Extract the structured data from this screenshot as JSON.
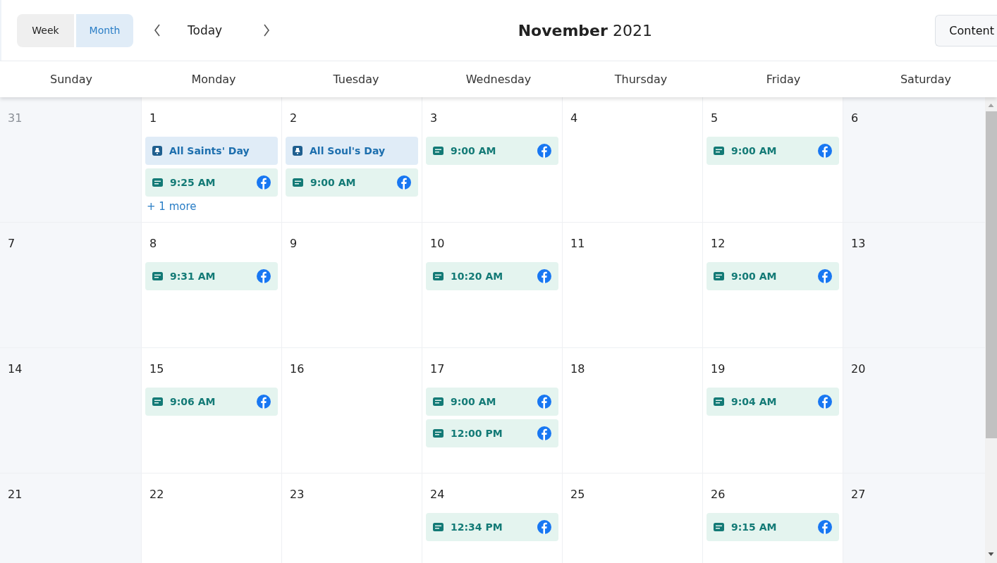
{
  "view_switch": [
    {
      "label": "Week",
      "selected": false
    },
    {
      "label": "Month",
      "selected": true
    }
  ],
  "today_button": "Today",
  "title": "**November** 2021",
  "content_button": "Content",
  "weekdays": [
    "Sunday",
    "Monday",
    "Tuesday",
    "Wednesday",
    "Thursday",
    "Friday",
    "Saturday"
  ],
  "weeks": [
    {
      "days": [
        {
          "number": "31",
          "outside_month": true
        },
        {
          "number": "1",
          "outside_month": false,
          "events": [
            {
              "kind": "holiday",
              "label": "All Saints' Day"
            },
            {
              "kind": "post",
              "label": "9:25 AM"
            }
          ],
          "more": "+ 1 more"
        },
        {
          "number": "2",
          "outside_month": false,
          "events": [
            {
              "kind": "holiday",
              "label": "All Soul's Day"
            },
            {
              "kind": "post",
              "label": "9:00 AM"
            }
          ]
        },
        {
          "number": "3",
          "outside_month": false,
          "events": [
            {
              "kind": "post",
              "label": "9:00 AM"
            }
          ]
        },
        {
          "number": "4",
          "outside_month": false
        },
        {
          "number": "5",
          "outside_month": false,
          "events": [
            {
              "kind": "post",
              "label": "9:00 AM"
            }
          ]
        },
        {
          "number": "6",
          "outside_month": false
        }
      ]
    },
    {
      "days": [
        {
          "number": "7",
          "outside_month": false
        },
        {
          "number": "8",
          "outside_month": false,
          "events": [
            {
              "kind": "post",
              "label": "9:31 AM"
            }
          ]
        },
        {
          "number": "9",
          "outside_month": false
        },
        {
          "number": "10",
          "outside_month": false,
          "events": [
            {
              "kind": "post",
              "label": "10:20 AM"
            }
          ]
        },
        {
          "number": "11",
          "outside_month": false
        },
        {
          "number": "12",
          "outside_month": false,
          "events": [
            {
              "kind": "post",
              "label": "9:00 AM"
            }
          ]
        },
        {
          "number": "13",
          "outside_month": false
        }
      ]
    },
    {
      "days": [
        {
          "number": "14",
          "outside_month": false
        },
        {
          "number": "15",
          "outside_month": false,
          "events": [
            {
              "kind": "post",
              "label": "9:06 AM"
            }
          ]
        },
        {
          "number": "16",
          "outside_month": false
        },
        {
          "number": "17",
          "outside_month": false,
          "events": [
            {
              "kind": "post",
              "label": "9:00 AM"
            },
            {
              "kind": "post",
              "label": "12:00 PM"
            }
          ]
        },
        {
          "number": "18",
          "outside_month": false
        },
        {
          "number": "19",
          "outside_month": false,
          "events": [
            {
              "kind": "post",
              "label": "9:04 AM"
            }
          ]
        },
        {
          "number": "20",
          "outside_month": false
        }
      ]
    },
    {
      "days": [
        {
          "number": "21",
          "outside_month": false
        },
        {
          "number": "22",
          "outside_month": false
        },
        {
          "number": "23",
          "outside_month": false
        },
        {
          "number": "24",
          "outside_month": false,
          "events": [
            {
              "kind": "post",
              "label": "12:34 PM"
            }
          ]
        },
        {
          "number": "25",
          "outside_month": false
        },
        {
          "number": "26",
          "outside_month": false,
          "events": [
            {
              "kind": "post",
              "label": "9:15 AM"
            }
          ]
        },
        {
          "number": "27",
          "outside_month": false
        }
      ]
    }
  ]
}
